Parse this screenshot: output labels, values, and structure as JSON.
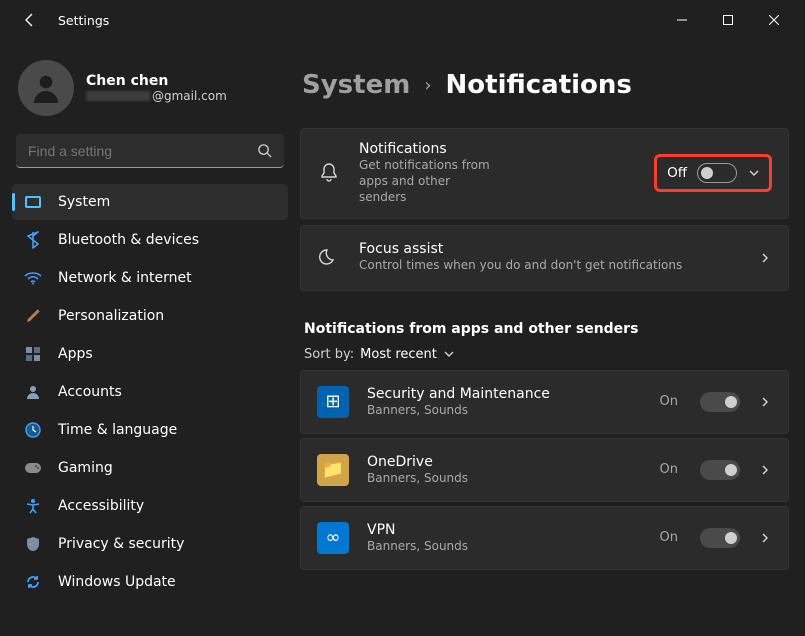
{
  "window": {
    "title": "Settings"
  },
  "user": {
    "name": "Chen chen",
    "email_suffix": "@gmail.com"
  },
  "search": {
    "placeholder": "Find a setting"
  },
  "sidebar": {
    "items": [
      {
        "label": "System",
        "selected": true
      },
      {
        "label": "Bluetooth & devices"
      },
      {
        "label": "Network & internet"
      },
      {
        "label": "Personalization"
      },
      {
        "label": "Apps"
      },
      {
        "label": "Accounts"
      },
      {
        "label": "Time & language"
      },
      {
        "label": "Gaming"
      },
      {
        "label": "Accessibility"
      },
      {
        "label": "Privacy & security"
      },
      {
        "label": "Windows Update"
      }
    ]
  },
  "breadcrumb": {
    "parent": "System",
    "current": "Notifications"
  },
  "cards": {
    "notifications": {
      "title": "Notifications",
      "sub": "Get notifications from apps and other senders",
      "toggle_label": "Off",
      "toggle_on": false
    },
    "focus": {
      "title": "Focus assist",
      "sub": "Control times when you do and don't get notifications"
    }
  },
  "section_heading": "Notifications from apps and other senders",
  "sort": {
    "label": "Sort by:",
    "value": "Most recent"
  },
  "apps": [
    {
      "title": "Security and Maintenance",
      "sub": "Banners, Sounds",
      "state": "On",
      "icon_bg": "#0063b1",
      "icon_glyph": "⊞"
    },
    {
      "title": "OneDrive",
      "sub": "Banners, Sounds",
      "state": "On",
      "icon_bg": "#d1a447",
      "icon_glyph": "📁"
    },
    {
      "title": "VPN",
      "sub": "Banners, Sounds",
      "state": "On",
      "icon_bg": "#0078d4",
      "icon_glyph": "∞"
    }
  ]
}
